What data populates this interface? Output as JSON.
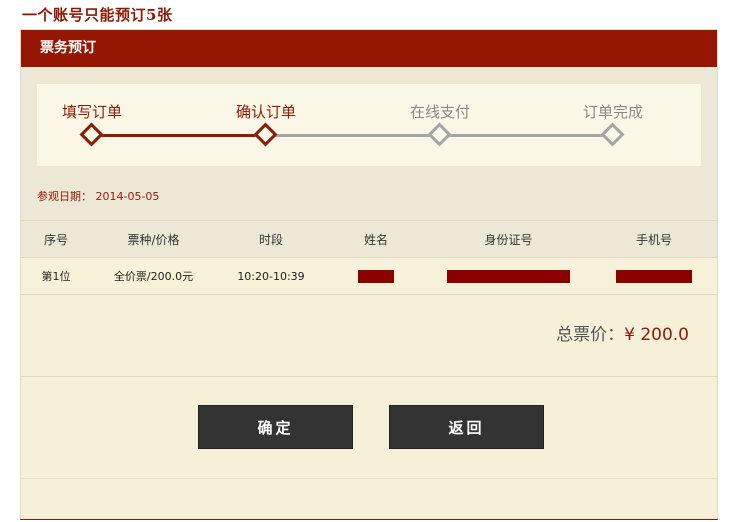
{
  "notice": "一个账号只能预订5张",
  "panel": {
    "title": "票务预订"
  },
  "steps": [
    {
      "label": "填写订单",
      "state": "done"
    },
    {
      "label": "确认订单",
      "state": "current"
    },
    {
      "label": "在线支付",
      "state": "pending"
    },
    {
      "label": "订单完成",
      "state": "pending"
    }
  ],
  "visit_date": {
    "label": "参观日期：",
    "value": "2014-05-05"
  },
  "table": {
    "columns": [
      "序号",
      "票种/价格",
      "时段",
      "姓名",
      "身份证号",
      "手机号"
    ],
    "rows": [
      {
        "index": "第1位",
        "ticket": "全价票/200.0元",
        "time": "10:20-10:39",
        "name": "",
        "id_number": "",
        "phone": ""
      }
    ]
  },
  "total": {
    "label": "总票价：",
    "value": "¥ 200.0"
  },
  "buttons": {
    "confirm": "确定",
    "back": "返回"
  },
  "colors": {
    "brand": "#951603",
    "accent": "#8e1a06",
    "inactive": "#a5a5a5",
    "button": "#333333"
  }
}
